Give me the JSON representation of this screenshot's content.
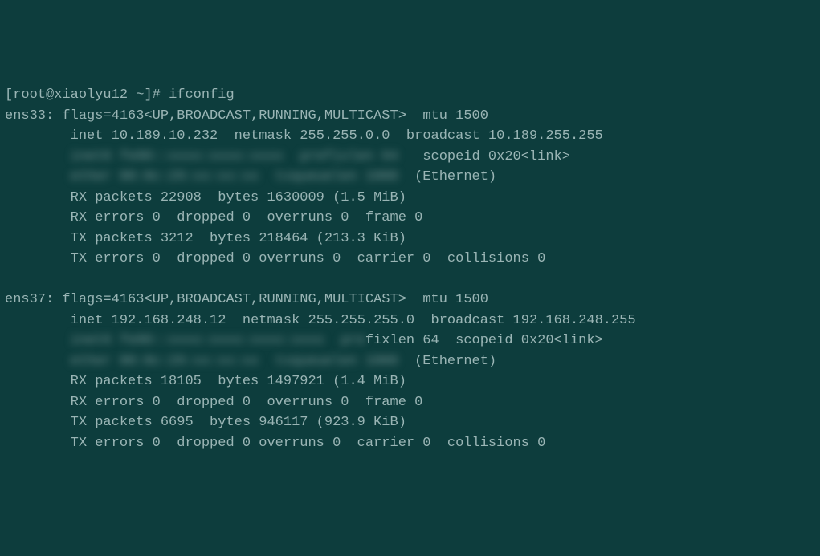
{
  "prompt": {
    "user": "root",
    "host": "xiaolyu12",
    "path": "~",
    "symbol": "#",
    "command": "ifconfig"
  },
  "interfaces": [
    {
      "name": "ens33",
      "flags": "flags=4163<UP,BROADCAST,RUNNING,MULTICAST>",
      "mtu": "mtu 1500",
      "inet": "inet 10.189.10.232",
      "netmask": "netmask 255.255.0.0",
      "broadcast": "broadcast 10.189.255.255",
      "scopeid": "scopeid 0x20<link>",
      "ethernet": "(Ethernet)",
      "rx_packets": "RX packets 22908  bytes 1630009 (1.5 MiB)",
      "rx_errors": "RX errors 0  dropped 0  overruns 0  frame 0",
      "tx_packets": "TX packets 3212  bytes 218464 (213.3 KiB)",
      "tx_errors": "TX errors 0  dropped 0 overruns 0  carrier 0  collisions 0",
      "blur_inet6": "inet6 fe80::xxxx:xxxx:xxxx  prefixlen 64",
      "blur_ether": "ether 00:0c:29:xx:xx:xx  txqueuelen 1000"
    },
    {
      "name": "ens37",
      "flags": "flags=4163<UP,BROADCAST,RUNNING,MULTICAST>",
      "mtu": "mtu 1500",
      "inet": "inet 192.168.248.12",
      "netmask": "netmask 255.255.255.0",
      "broadcast": "broadcast 192.168.248.255",
      "prefixlen": "fixlen 64",
      "scopeid": "scopeid 0x20<link>",
      "ethernet": "(Ethernet)",
      "rx_packets": "RX packets 18105  bytes 1497921 (1.4 MiB)",
      "rx_errors": "RX errors 0  dropped 0  overruns 0  frame 0",
      "tx_packets": "TX packets 6695  bytes 946117 (923.9 KiB)",
      "tx_errors": "TX errors 0  dropped 0 overruns 0  carrier 0  collisions 0",
      "blur_inet6": "inet6 fe80::xxxx:xxxx:xxxx:xxxx  pre",
      "blur_ether": "ether 00:0c:29:xx:xx:xx  txqueuelen 1000"
    }
  ]
}
